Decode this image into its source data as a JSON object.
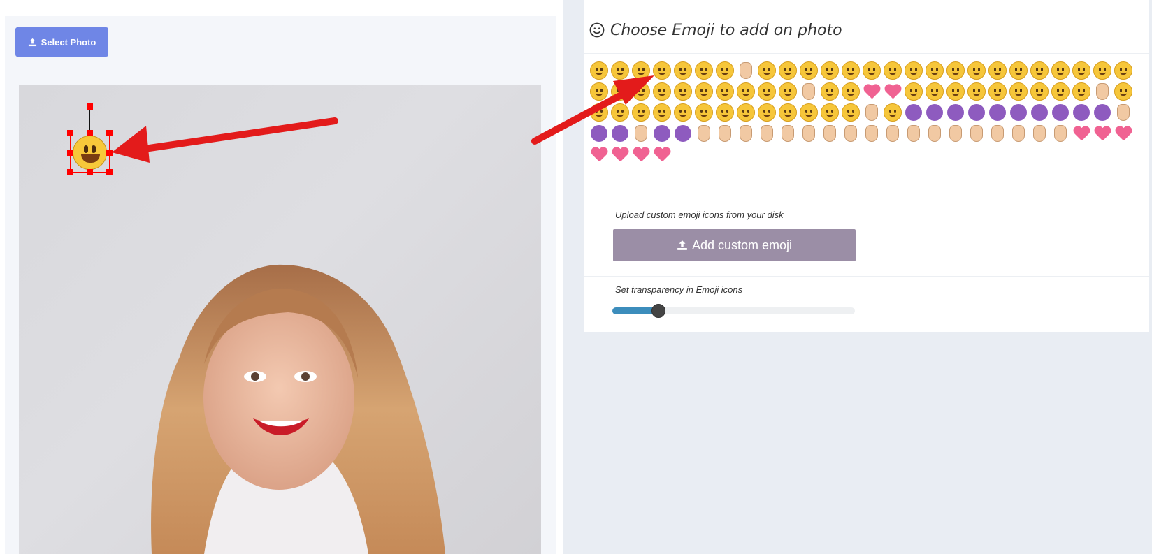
{
  "toolbar": {
    "select_photo_label": "Select Photo",
    "upload_icon": "upload-icon"
  },
  "photo": {
    "description_icon": "portrait-photo"
  },
  "emoji_panel": {
    "title": "Choose Emoji to add on photo",
    "title_icon": "smiley-outline-icon",
    "emoji_names": [
      "slightly-smiling-face",
      "upside-down-face",
      "grimacing-face",
      "smiling-face",
      "grinning-face",
      "laughing-face",
      "sweat-smile-face",
      "tears-of-joy-face",
      "smirking-face",
      "unamused-face",
      "pensive-face",
      "relieved-face",
      "money-mouth-face",
      "stuck-out-tongue-face",
      "squinting-tongue-face",
      "winking-tongue-face",
      "hugging-face",
      "blushing-face",
      "smiling-eyes-face",
      "kissing-closed-eyes-face",
      "kissing-face",
      "kissing-smiling-eyes-face",
      "nerd-face",
      "sunglasses-face",
      "star-struck-face",
      "grimacing-face-2",
      "yum-face",
      "winking-face",
      "no-mouth-face",
      "hushed-face",
      "frowning-face",
      "astonished-face",
      "rolling-eyes-face",
      "anguished-face",
      "thinking-face",
      "sleepy-face",
      "fearful-face",
      "cold-sweat-face",
      "screaming-face",
      "heart-eyes-face",
      "kissing-heart-face",
      "flushed-face",
      "innocent-face",
      "halo-face",
      "sleeping-face",
      "expressionless-face",
      "neutral-face",
      "slightly-frowning-face",
      "confused-face",
      "triumph-face",
      "weary-face",
      "tired-face",
      "persevering-face",
      "confounded-face",
      "dizzy-face",
      "dizzy-face-2",
      "zipper-mouth-face",
      "medical-mask-face",
      "thermometer-face",
      "bandage-face",
      "angry-face",
      "pouting-face",
      "downcast-sweat-face",
      "sweat-face",
      "loudly-crying-face",
      "disappointed-face",
      "crying-face",
      "pile-of-poo",
      "smiling-devil",
      "angry-devil",
      "alien",
      "ghost",
      "tongue",
      "alien-monster",
      "eyes",
      "dancer",
      "dancers",
      "woman-tipping-hand",
      "woman-gesturing-no",
      "woman-gesturing-ok",
      "woman-raising-hand",
      "woman-bowing",
      "woman-getting-haircut",
      "nail-polish",
      "waving-hand",
      "victory-hand",
      "index-pointing-up",
      "point-up-2",
      "thumbs-up",
      "thumbs-down",
      "raised-fist",
      "ear",
      "ok-hand",
      "raising-hands",
      "oncoming-fist",
      "clapping-hands",
      "flexed-biceps",
      "folded-hands",
      "sign-of-horns",
      "vulcan-salute",
      "middle-finger",
      "sparkling-heart",
      "revolving-hearts",
      "beating-heart",
      "growing-heart",
      "gift-heart",
      "heart-with-arrow",
      "broken-heart"
    ]
  },
  "custom": {
    "upload_label": "Upload custom emoji icons from your disk",
    "add_button_label": "Add custom emoji"
  },
  "transparency": {
    "label": "Set transparency in Emoji icons",
    "value_fraction": 0.19
  },
  "placed_emoji": {
    "name": "grinning-face"
  },
  "colors": {
    "primary_button": "#6f86e6",
    "secondary_button": "#9b8ea6",
    "slider_fill": "#3c8dbc",
    "selection": "#ff0000",
    "annotation_arrow": "#e31b1b"
  }
}
